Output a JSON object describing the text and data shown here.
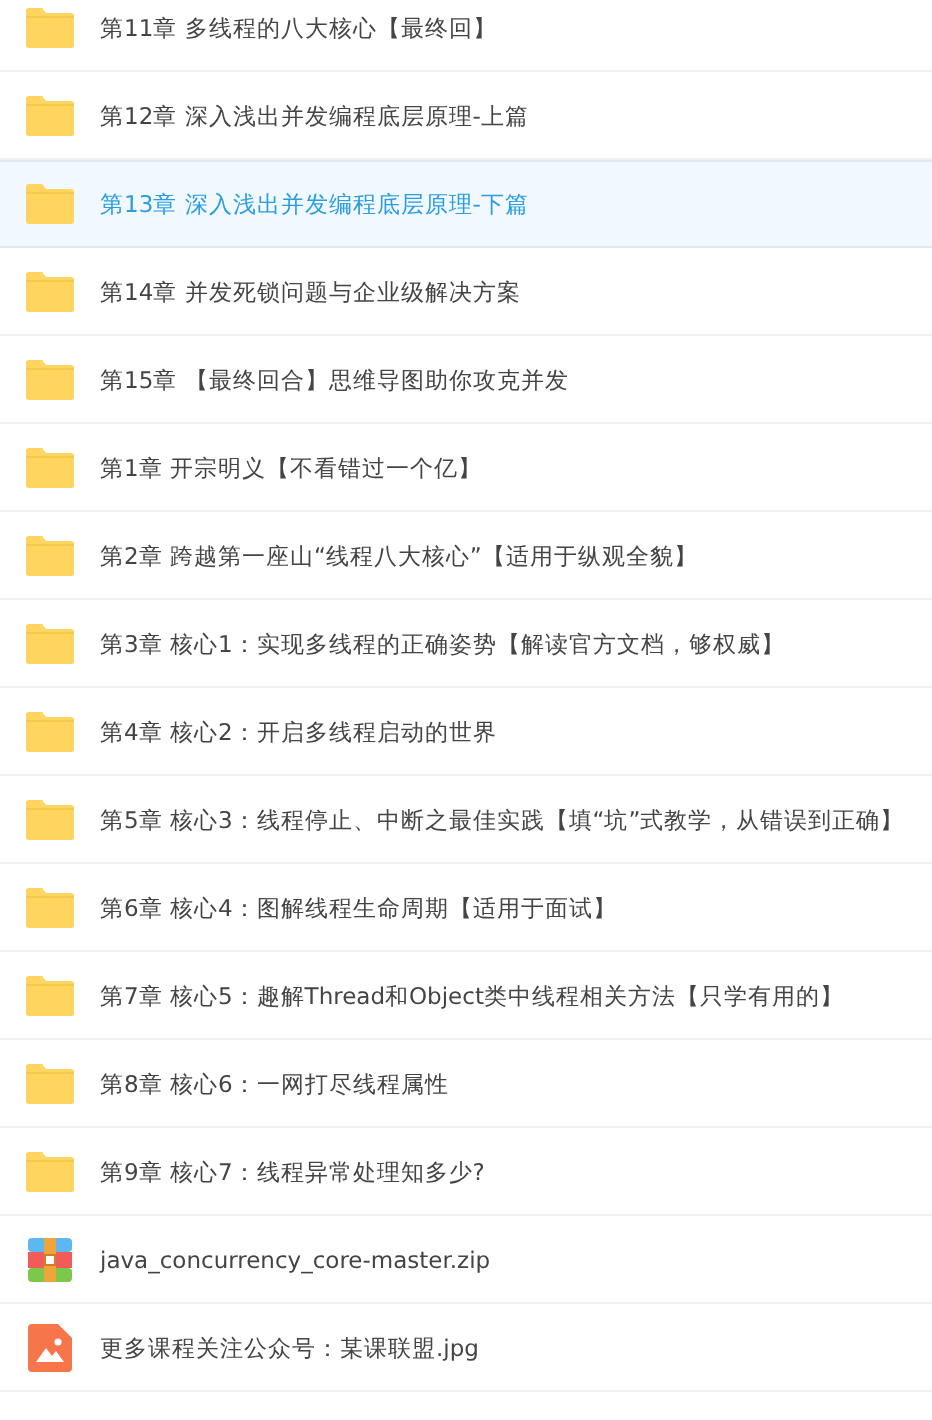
{
  "files": [
    {
      "kind": "folder",
      "name": "第11章 多线程的八大核心【最终回】",
      "selected": false
    },
    {
      "kind": "folder",
      "name": "第12章 深入浅出并发编程底层原理-上篇",
      "selected": false
    },
    {
      "kind": "folder",
      "name": "第13章 深入浅出并发编程底层原理-下篇",
      "selected": true
    },
    {
      "kind": "folder",
      "name": "第14章 并发死锁问题与企业级解决方案",
      "selected": false
    },
    {
      "kind": "folder",
      "name": "第15章 【最终回合】思维导图助你攻克并发",
      "selected": false
    },
    {
      "kind": "folder",
      "name": "第1章 开宗明义【不看错过一个亿】",
      "selected": false
    },
    {
      "kind": "folder",
      "name": "第2章 跨越第一座山“线程八大核心”【适用于纵观全貌】",
      "selected": false
    },
    {
      "kind": "folder",
      "name": "第3章 核心1：实现多线程的正确姿势【解读官方文档，够权威】",
      "selected": false
    },
    {
      "kind": "folder",
      "name": "第4章 核心2：开启多线程启动的世界",
      "selected": false
    },
    {
      "kind": "folder",
      "name": "第5章 核心3：线程停止、中断之最佳实践【填“坑”式教学，从错误到正确】",
      "selected": false
    },
    {
      "kind": "folder",
      "name": "第6章 核心4：图解线程生命周期【适用于面试】",
      "selected": false
    },
    {
      "kind": "folder",
      "name": "第7章 核心5：趣解Thread和Object类中线程相关方法【只学有用的】",
      "selected": false
    },
    {
      "kind": "folder",
      "name": "第8章 核心6：一网打尽线程属性",
      "selected": false
    },
    {
      "kind": "folder",
      "name": "第9章 核心7：线程异常处理知多少?",
      "selected": false
    },
    {
      "kind": "zip",
      "name": "java_concurrency_core-master.zip",
      "selected": false
    },
    {
      "kind": "image",
      "name": "更多课程关注公众号：某课联盟.jpg",
      "selected": false
    }
  ]
}
